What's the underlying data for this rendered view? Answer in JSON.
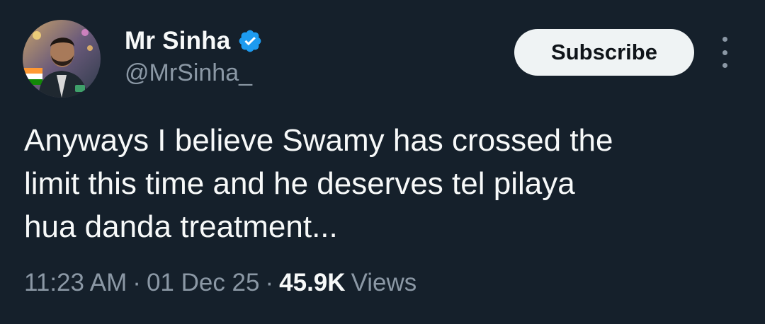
{
  "author": {
    "display_name": "Mr Sinha",
    "handle": "@MrSinha_",
    "verified_icon": "verified-badge-icon",
    "avatar": "profile-photo"
  },
  "actions": {
    "subscribe_label": "Subscribe",
    "more_icon": "more-vertical-icon"
  },
  "tweet": {
    "text": "Anyways I believe Swamy has crossed the\nlimit this time and he deserves tel pilaya\nhua danda treatment..."
  },
  "meta": {
    "time": "11:23 AM",
    "separator": "·",
    "date": "01 Dec 25",
    "views_count": "45.9K",
    "views_label": "Views"
  },
  "colors": {
    "background": "#15202b",
    "primary_text": "#f7f9f9",
    "secondary_text": "#8b98a5",
    "verified_blue": "#1d9bf0",
    "button_bg": "#eff3f4"
  }
}
